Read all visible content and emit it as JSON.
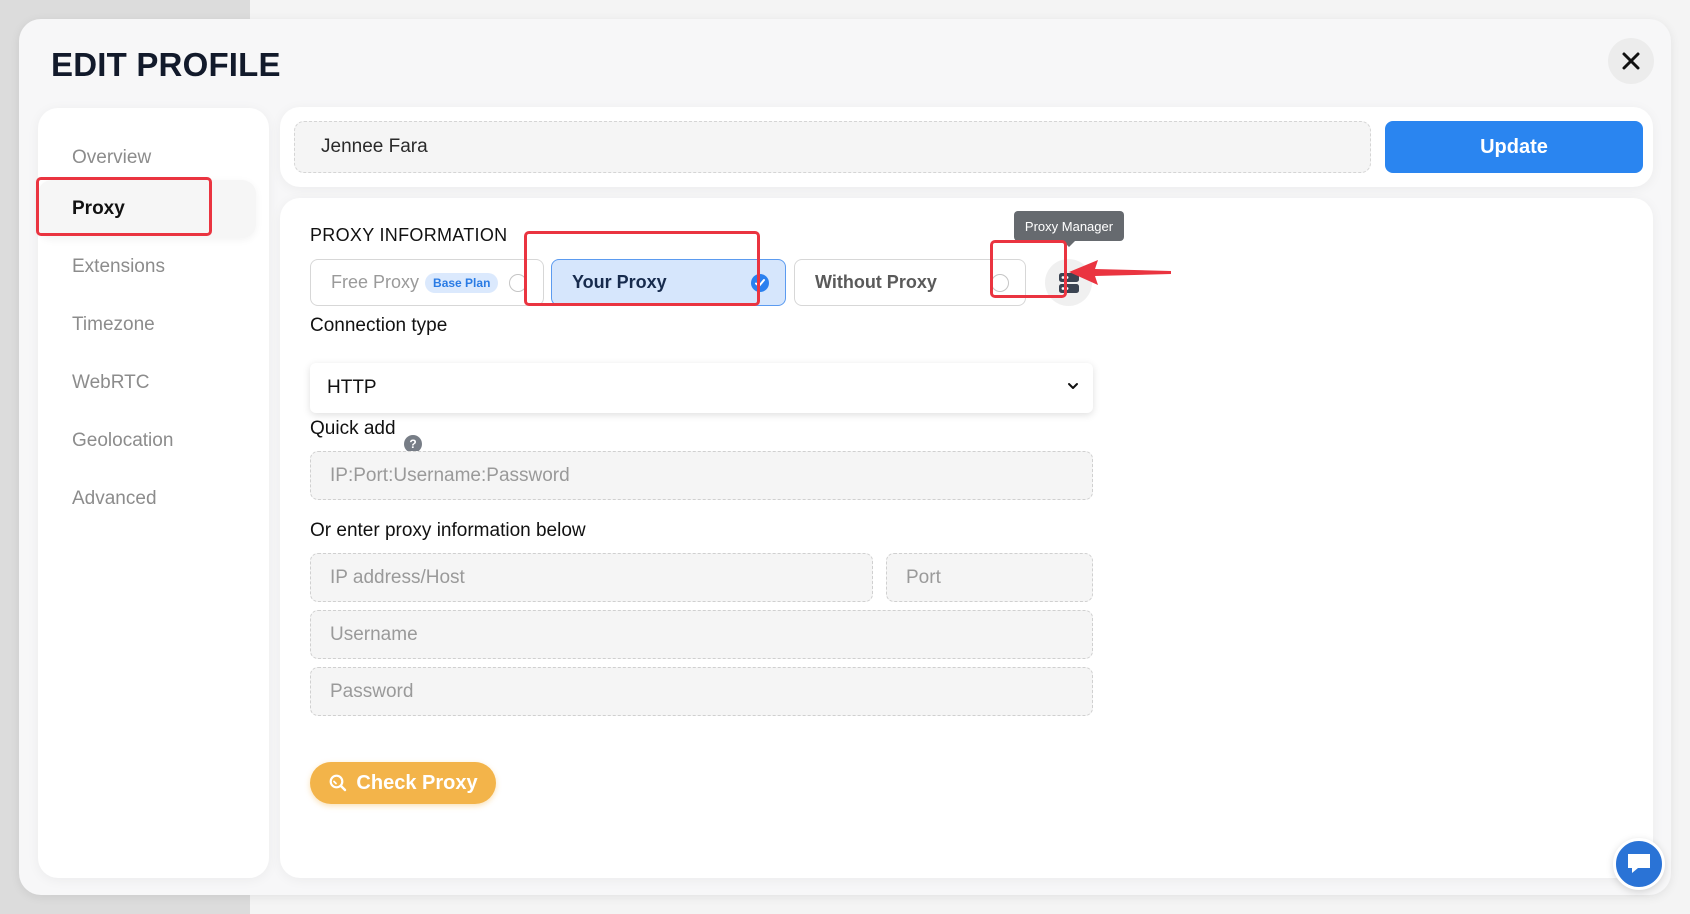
{
  "modal": {
    "title": "EDIT PROFILE"
  },
  "sidebar": {
    "items": [
      {
        "label": "Overview"
      },
      {
        "label": "Proxy"
      },
      {
        "label": "Extensions"
      },
      {
        "label": "Timezone"
      },
      {
        "label": "WebRTC"
      },
      {
        "label": "Geolocation"
      },
      {
        "label": "Advanced"
      }
    ],
    "active": "Proxy"
  },
  "profile": {
    "name_value": "Jennee Fara",
    "update_label": "Update"
  },
  "proxy": {
    "section_title": "PROXY INFORMATION",
    "options": {
      "free": {
        "label": "Free Proxy",
        "badge": "Base Plan"
      },
      "yours": {
        "label": "Your Proxy"
      },
      "without": {
        "label": "Without Proxy"
      }
    },
    "selected": "Your Proxy",
    "manager_tooltip": "Proxy Manager",
    "connection_type_label": "Connection type",
    "connection_type_value": "HTTP",
    "quick_add_label": "Quick add",
    "quick_add_help": "?",
    "quick_add_placeholder": "IP:Port:Username:Password",
    "manual_label": "Or enter proxy information below",
    "host_placeholder": "IP address/Host",
    "port_placeholder": "Port",
    "username_placeholder": "Username",
    "password_placeholder": "Password",
    "check_label": "Check Proxy"
  },
  "colors": {
    "accent_blue": "#2a85f0",
    "check_orange": "#f3b44a",
    "highlight_red": "#ea3440",
    "selected_option_bg": "#d6e6fc"
  },
  "icons": {
    "close": "close-icon",
    "proxy_manager": "server-icon",
    "check_proxy": "search-icon",
    "chat": "chat-icon",
    "annotation": "arrow-left-icon"
  }
}
